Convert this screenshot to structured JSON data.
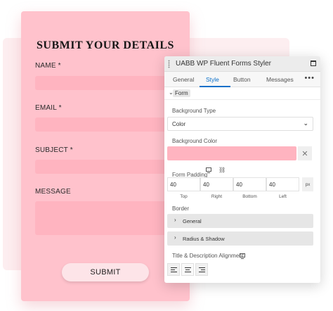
{
  "form": {
    "title": "SUBMIT YOUR DETAILS",
    "fields": [
      {
        "label": "NAME *"
      },
      {
        "label": "EMAIL *"
      },
      {
        "label": "SUBJECT *"
      },
      {
        "label": "MESSAGE"
      }
    ],
    "submit_label": "SUBMIT",
    "colors": {
      "card": "#ffc2cc",
      "input": "#ffb4c0"
    }
  },
  "panel": {
    "title": "UABB WP Fluent Forms Styler",
    "tabs": [
      "General",
      "Style",
      "Button",
      "Messages"
    ],
    "active_tab": "Style",
    "section": "Form",
    "background_type": {
      "label": "Background Type",
      "value": "Color"
    },
    "background_color": {
      "label": "Background Color",
      "value": "#ffb4c0"
    },
    "form_padding": {
      "label": "Form Padding",
      "values": [
        "40",
        "40",
        "40",
        "40"
      ],
      "unit": "px",
      "sides": [
        "Top",
        "Right",
        "Bottom",
        "Left"
      ]
    },
    "border": {
      "label": "Border",
      "items": [
        "General",
        "Radius & Shadow"
      ]
    },
    "alignment": {
      "label": "Title & Description Alignment"
    },
    "colors": {
      "accent": "#0c70c9"
    }
  }
}
